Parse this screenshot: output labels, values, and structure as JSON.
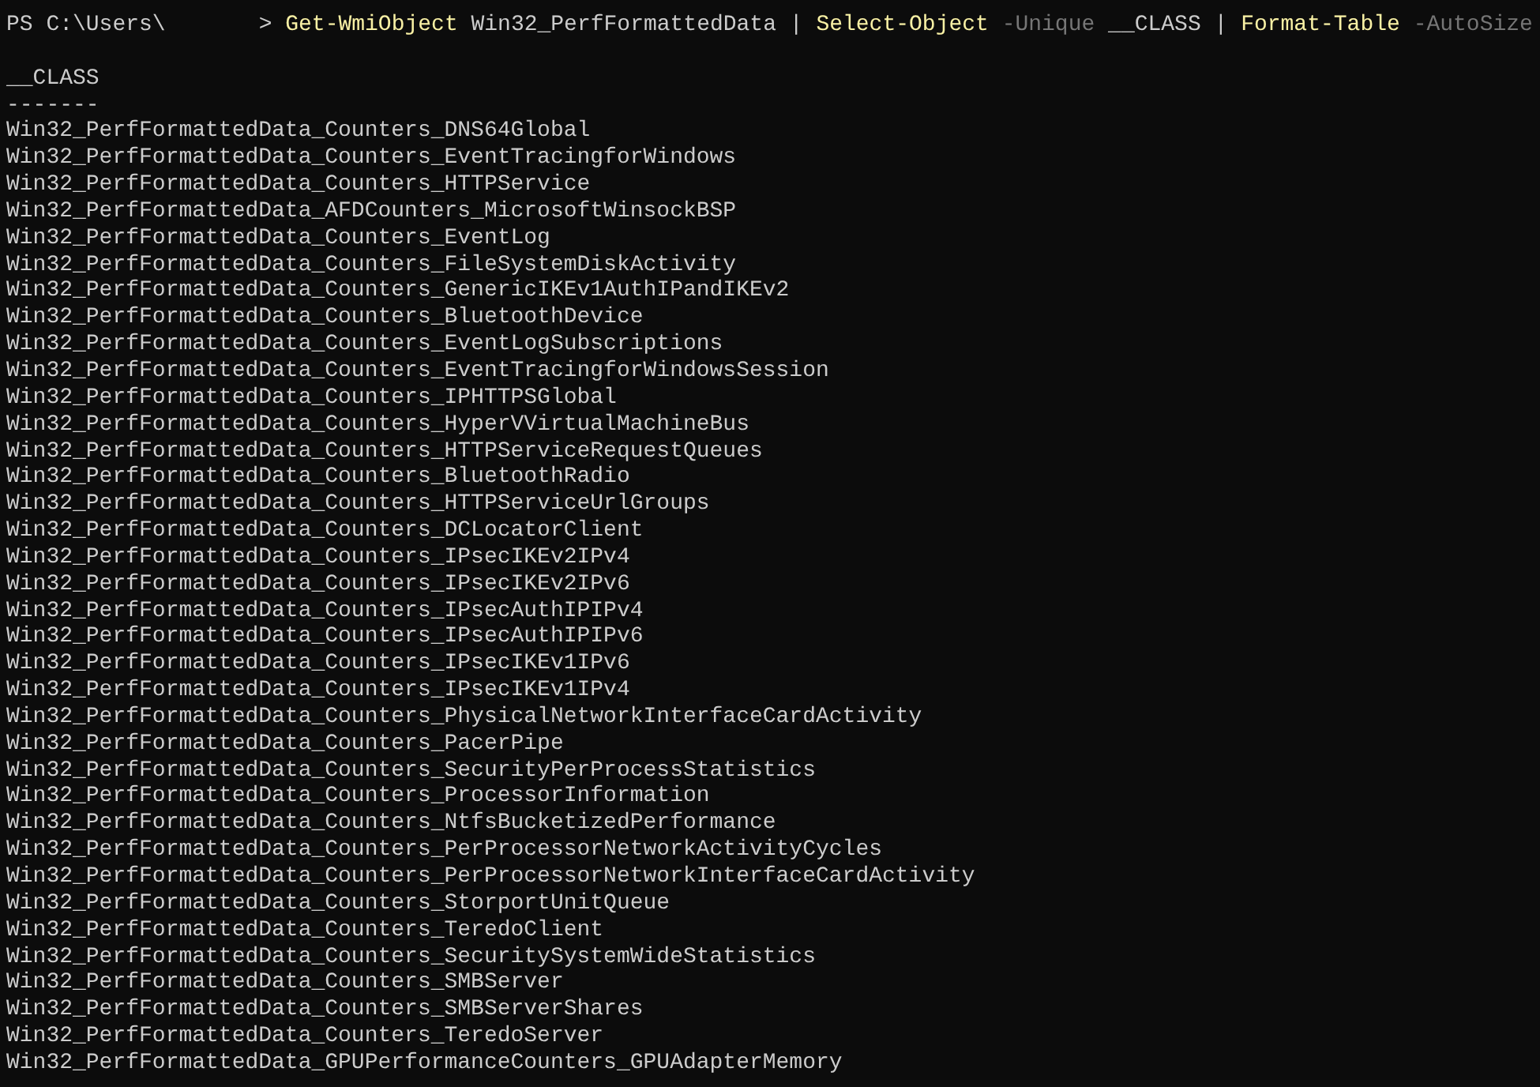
{
  "prompt": {
    "path": "PS C:\\Users\\",
    "symbol": ">"
  },
  "command": [
    {
      "kind": "cmdlet",
      "text": "Get-WmiObject"
    },
    {
      "kind": "argument",
      "text": "Win32_PerfFormattedData"
    },
    {
      "kind": "operator",
      "text": "|"
    },
    {
      "kind": "cmdlet",
      "text": "Select-Object"
    },
    {
      "kind": "parameter",
      "text": "-Unique"
    },
    {
      "kind": "argument",
      "text": "__CLASS"
    },
    {
      "kind": "operator",
      "text": "|"
    },
    {
      "kind": "cmdlet",
      "text": "Format-Table"
    },
    {
      "kind": "parameter",
      "text": "-AutoSize"
    }
  ],
  "table": {
    "columns": [
      {
        "header": "__CLASS",
        "underline": "-------"
      }
    ],
    "rows": [
      "Win32_PerfFormattedData_Counters_DNS64Global",
      "Win32_PerfFormattedData_Counters_EventTracingforWindows",
      "Win32_PerfFormattedData_Counters_HTTPService",
      "Win32_PerfFormattedData_AFDCounters_MicrosoftWinsockBSP",
      "Win32_PerfFormattedData_Counters_EventLog",
      "Win32_PerfFormattedData_Counters_FileSystemDiskActivity",
      "Win32_PerfFormattedData_Counters_GenericIKEv1AuthIPandIKEv2",
      "Win32_PerfFormattedData_Counters_BluetoothDevice",
      "Win32_PerfFormattedData_Counters_EventLogSubscriptions",
      "Win32_PerfFormattedData_Counters_EventTracingforWindowsSession",
      "Win32_PerfFormattedData_Counters_IPHTTPSGlobal",
      "Win32_PerfFormattedData_Counters_HyperVVirtualMachineBus",
      "Win32_PerfFormattedData_Counters_HTTPServiceRequestQueues",
      "Win32_PerfFormattedData_Counters_BluetoothRadio",
      "Win32_PerfFormattedData_Counters_HTTPServiceUrlGroups",
      "Win32_PerfFormattedData_Counters_DCLocatorClient",
      "Win32_PerfFormattedData_Counters_IPsecIKEv2IPv4",
      "Win32_PerfFormattedData_Counters_IPsecIKEv2IPv6",
      "Win32_PerfFormattedData_Counters_IPsecAuthIPIPv4",
      "Win32_PerfFormattedData_Counters_IPsecAuthIPIPv6",
      "Win32_PerfFormattedData_Counters_IPsecIKEv1IPv6",
      "Win32_PerfFormattedData_Counters_IPsecIKEv1IPv4",
      "Win32_PerfFormattedData_Counters_PhysicalNetworkInterfaceCardActivity",
      "Win32_PerfFormattedData_Counters_PacerPipe",
      "Win32_PerfFormattedData_Counters_SecurityPerProcessStatistics",
      "Win32_PerfFormattedData_Counters_ProcessorInformation",
      "Win32_PerfFormattedData_Counters_NtfsBucketizedPerformance",
      "Win32_PerfFormattedData_Counters_PerProcessorNetworkActivityCycles",
      "Win32_PerfFormattedData_Counters_PerProcessorNetworkInterfaceCardActivity",
      "Win32_PerfFormattedData_Counters_StorportUnitQueue",
      "Win32_PerfFormattedData_Counters_TeredoClient",
      "Win32_PerfFormattedData_Counters_SecuritySystemWideStatistics",
      "Win32_PerfFormattedData_Counters_SMBServer",
      "Win32_PerfFormattedData_Counters_SMBServerShares",
      "Win32_PerfFormattedData_Counters_TeredoServer",
      "Win32_PerfFormattedData_GPUPerformanceCounters_GPUAdapterMemory"
    ]
  }
}
